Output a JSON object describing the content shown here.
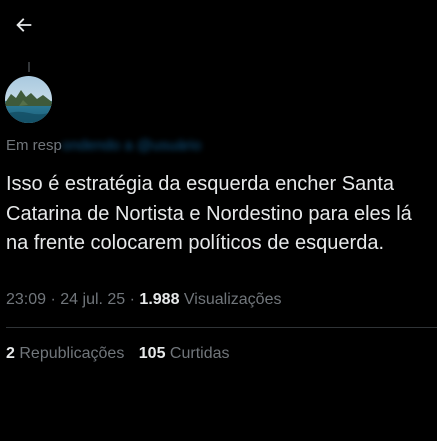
{
  "header": {
    "back_icon": "arrow-left-icon"
  },
  "avatar": {
    "icon": "avatar-landscape-image"
  },
  "tweet": {
    "reply_prefix": "Em resp",
    "reply_handle": "ondendo a @usuário",
    "text": "Isso é estratégia da esquerda encher Santa Catarina de Nortista e Nordestino para eles lá na frente colocarem políticos de esquerda.",
    "time": "23:09",
    "date": "24 jul. 25",
    "views_count": "1.988",
    "views_label": "Visualizações",
    "separator": " · "
  },
  "stats": {
    "reposts_count": "2",
    "reposts_label": "Republicações",
    "likes_count": "105",
    "likes_label": "Curtidas"
  },
  "colors": {
    "background": "#000000",
    "text": "#e7e9ea",
    "muted": "#71767b",
    "accent": "#1d9bf0",
    "divider": "#2f3336"
  }
}
